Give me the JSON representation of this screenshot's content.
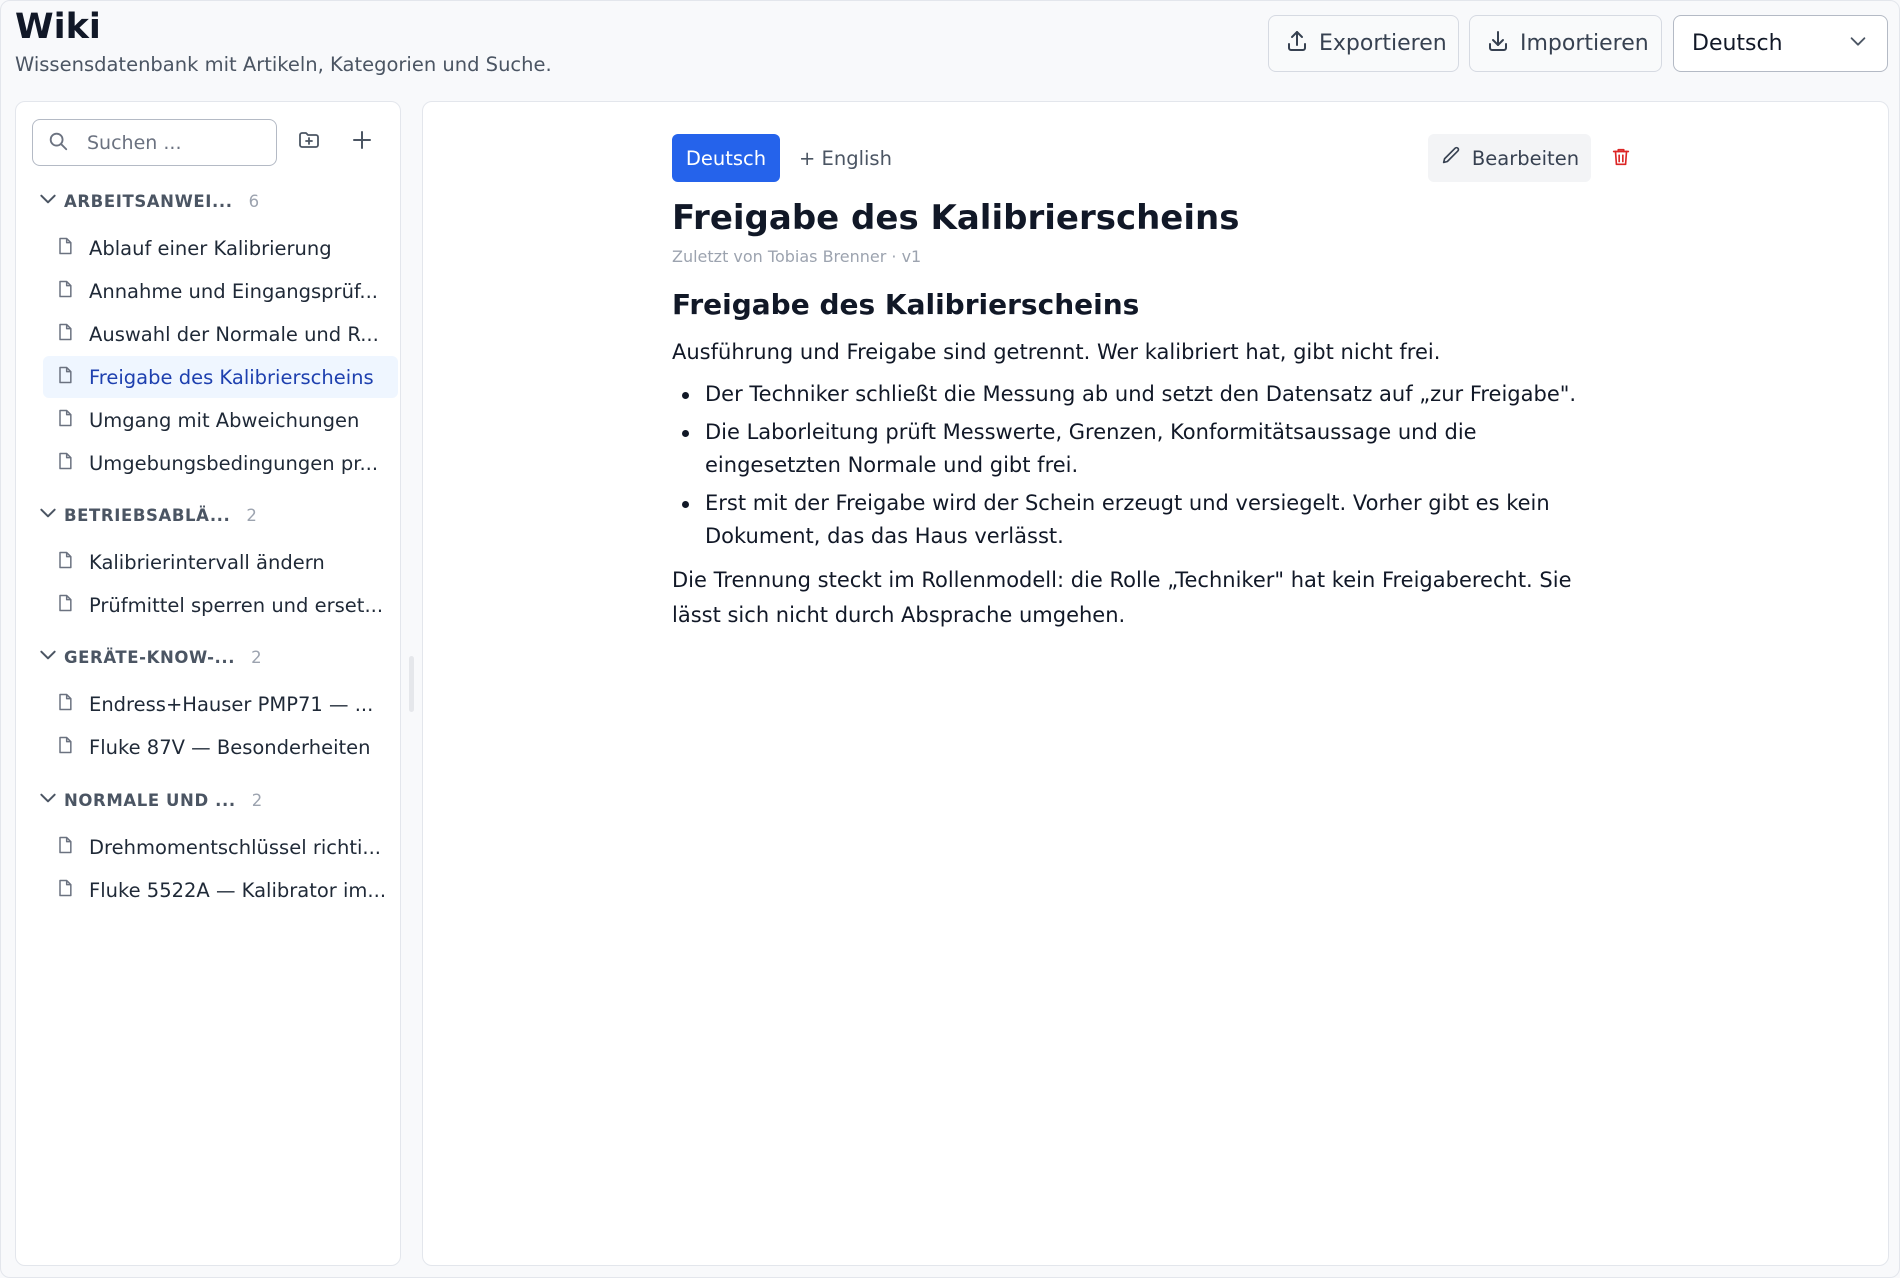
{
  "header": {
    "title": "Wiki",
    "subtitle": "Wissensdatenbank mit Artikeln, Kategorien und Suche.",
    "export_label": "Exportieren",
    "import_label": "Importieren",
    "language_select": "Deutsch"
  },
  "sidebar": {
    "search_placeholder": "Suchen ...",
    "categories": [
      {
        "name": "ARBEITSANWEI...",
        "count": "6",
        "articles": [
          "Ablauf einer Kalibrierung",
          "Annahme und Eingangsprüf...",
          "Auswahl der Normale und R...",
          "Freigabe des Kalibrierscheins",
          "Umgang mit Abweichungen",
          "Umgebungsbedingungen pr..."
        ]
      },
      {
        "name": "BETRIEBSABLÄ...",
        "count": "2",
        "articles": [
          "Kalibrierintervall ändern",
          "Prüfmittel sperren und erset..."
        ]
      },
      {
        "name": "GERÄTE-KNOW-...",
        "count": "2",
        "articles": [
          "Endress+Hauser PMP71 — ...",
          "Fluke 87V — Besonderheiten"
        ]
      },
      {
        "name": "NORMALE UND ...",
        "count": "2",
        "articles": [
          "Drehmomentschlüssel richti...",
          "Fluke 5522A — Kalibrator im..."
        ]
      }
    ]
  },
  "article": {
    "language_tabs": {
      "active": "Deutsch",
      "add": "+ English"
    },
    "edit_label": "Bearbeiten",
    "title": "Freigabe des Kalibrierscheins",
    "meta": "Zuletzt von Tobias Brenner · v1",
    "heading": "Freigabe des Kalibrierscheins",
    "intro": "Ausführung und Freigabe sind getrennt. Wer kalibriert hat, gibt nicht frei.",
    "bullets": [
      "Der Techniker schließt die Messung ab und setzt den Datensatz auf „zur Freigabe\".",
      "Die Laborleitung prüft Messwerte, Grenzen, Konformitätsaussage und die eingesetzten Normale und gibt frei.",
      "Erst mit der Freigabe wird der Schein erzeugt und versiegelt. Vorher gibt es kein Dokument, das das Haus verlässt."
    ],
    "closing": "Die Trennung steckt im Rollenmodell: die Rolle „Techniker\" hat kein Freigaberecht. Sie lässt sich nicht durch Absprache umgehen."
  },
  "colors": {
    "accent": "#2563eb",
    "active_item_bg": "#eff6ff",
    "active_item_text": "#1e40af",
    "danger": "#dc2626"
  }
}
